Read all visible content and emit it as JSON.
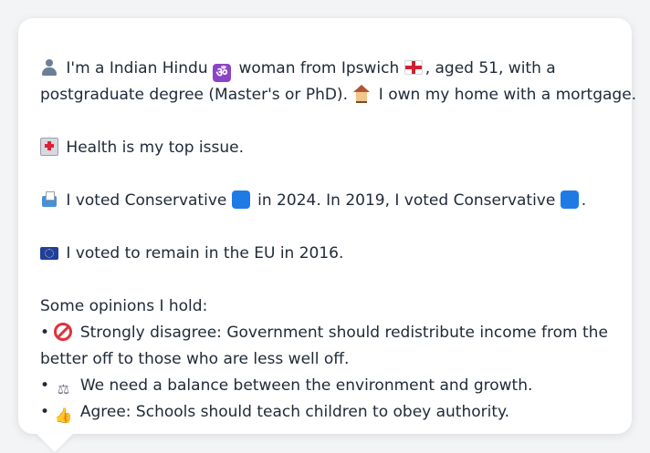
{
  "persona": {
    "intro": {
      "part1": "I'm a Indian Hindu",
      "part2": "woman from Ipswich",
      "part3": ", aged 51, with a",
      "part4": "postgraduate degree (Master's or PhD).",
      "part5": "I own my home with a mortgage.",
      "icons": [
        "person-icon",
        "om-icon",
        "flag-england-icon",
        "house-icon"
      ]
    },
    "top_issue": {
      "text": "Health is my top issue.",
      "icon": "hospital-icon"
    },
    "vote_history": {
      "part1": "I voted Conservative",
      "part2": "in 2024. In 2019, I voted Conservative",
      "part3": ".",
      "icons": [
        "ballot-box-icon",
        "blue-square-icon"
      ],
      "party_color": "#1e7be6"
    },
    "brexit": {
      "text": "I voted to remain in the EU in 2016.",
      "icon": "eu-flag-icon"
    },
    "opinions": {
      "heading": "Some opinions I hold:",
      "bullet": "•",
      "items": [
        {
          "line1": "Strongly disagree: Government should redistribute income from the",
          "line2": "better off to those who are less well off.",
          "icon": "no-entry-icon"
        },
        {
          "line1": "We need a balance between the environment and growth.",
          "icon": "balance-scale-icon"
        },
        {
          "line1": "Agree: Schools should teach children to obey authority.",
          "icon": "thumbs-up-icon"
        }
      ]
    }
  },
  "colors": {
    "background": "#f3f4f6",
    "card": "#ffffff",
    "text": "#1f2937"
  }
}
